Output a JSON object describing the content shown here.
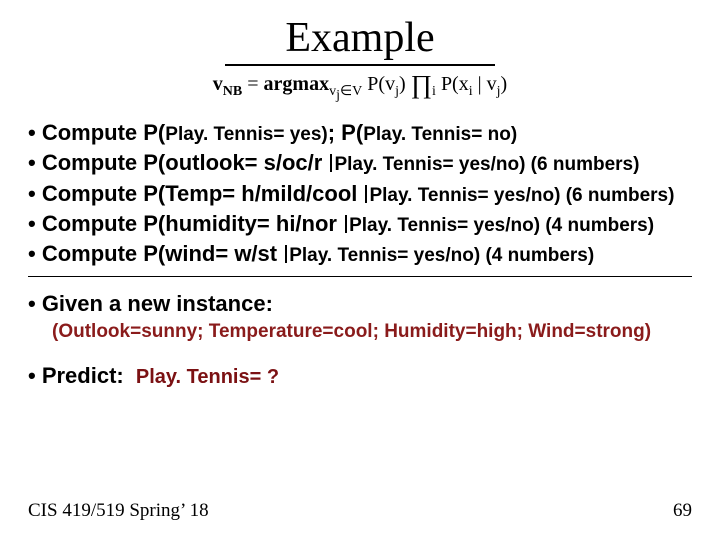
{
  "title": "Example",
  "formula": {
    "lhs_var": "v",
    "lhs_sub": "NB",
    "eq": "=",
    "argmax": "argmax",
    "argmax_sub": "v",
    "argmax_sub2": "j",
    "argmax_in": "∈V",
    "p1": "P(v",
    "p1_sub": "j",
    "p1_close": ")",
    "prod": "∏",
    "prod_sub": "i",
    "p2": "P(x",
    "p2_sub": "i",
    "mid": " | v",
    "p2_sub2": "j",
    "p2_close": ")"
  },
  "lines": {
    "l1a": "• Compute P(",
    "l1b": "Play. Tennis= yes)",
    "l1c": ";   P(",
    "l1d": "Play. Tennis= no)",
    "l2a": "• Compute P(outlook= s/oc/r     ",
    "l2b": "Play. Tennis= yes/no) (6 numbers)",
    "l3a": "• Compute P(Temp= h/mild/cool ",
    "l3b": "Play. Tennis= yes/no) (6 numbers)",
    "l4a": "• Compute P(humidity= hi/nor    ",
    "l4b": "Play. Tennis= yes/no) (4 numbers)",
    "l5a": "• Compute P(wind= w/st             ",
    "l5b": "Play. Tennis= yes/no) (4 numbers)"
  },
  "given": "• Given  a new instance:",
  "instance": "(Outlook=sunny;  Temperature=cool; Humidity=high; Wind=strong)",
  "predict_label": "• Predict:",
  "predict_value": "Play. Tennis= ?",
  "footer_left": "CIS 419/519 Spring’ 18",
  "footer_right": "69"
}
